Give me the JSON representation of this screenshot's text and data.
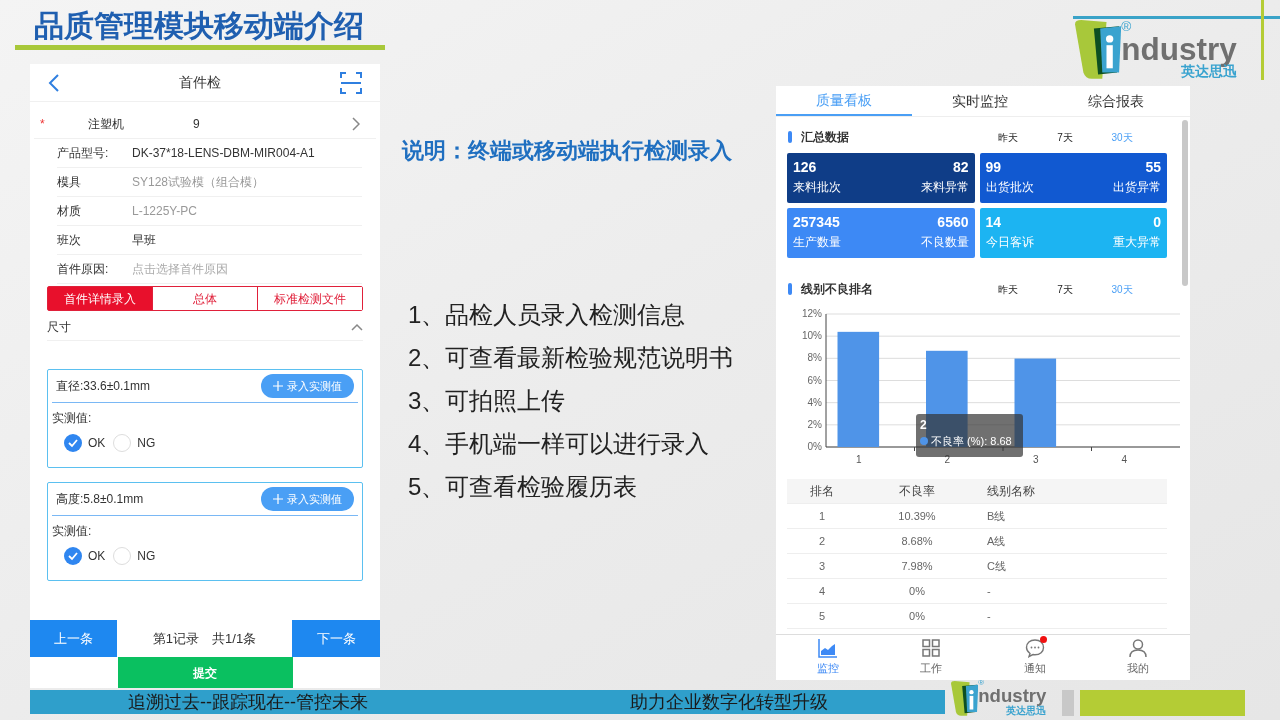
{
  "slide_title": "品质管理模块移动端介绍",
  "logo": {
    "registered": "®",
    "word": "ndustry",
    "subtitle": "英达思迅"
  },
  "description": "说明：终端或移动端执行检测录入",
  "points": [
    "1、品检人员录入检测信息",
    "2、可查看最新检验规范说明书",
    "3、可拍照上传",
    "4、手机端一样可以进行录入",
    "5、可查看检验履历表"
  ],
  "inspection_app": {
    "title": "首件检",
    "machine": {
      "required_mark": "*",
      "label": "注塑机",
      "value": "9"
    },
    "fields": [
      {
        "label": "产品型号:",
        "value": "DK-37*18-LENS-DBM-MIR004-A1",
        "muted": false
      },
      {
        "label": "模具",
        "value": "SY128试验模（组合模）",
        "muted": true
      },
      {
        "label": "材质",
        "value": "L-1225Y-PC",
        "muted": true
      },
      {
        "label": "班次",
        "value": "早班",
        "muted": false
      },
      {
        "label": "首件原因:",
        "placeholder": "点击选择首件原因"
      }
    ],
    "tabs": [
      {
        "label": "首件详情录入",
        "selected": true
      },
      {
        "label": "总体",
        "selected": false
      },
      {
        "label": "标准检测文件",
        "selected": false
      }
    ],
    "section": {
      "title": "尺寸",
      "expanded": true
    },
    "measurements": [
      {
        "spec": "直径:33.6±0.1mm",
        "button": "录入实测值",
        "value_label": "实测值:",
        "options": [
          {
            "label": "OK",
            "selected": true
          },
          {
            "label": "NG",
            "selected": false
          }
        ]
      },
      {
        "spec": "高度:5.8±0.1mm",
        "button": "录入实测值",
        "value_label": "实测值:",
        "options": [
          {
            "label": "OK",
            "selected": true
          },
          {
            "label": "NG",
            "selected": false
          }
        ]
      }
    ],
    "prev_button": "上一条",
    "record_info": "第1记录　共1/1条",
    "next_button": "下一条",
    "submit_button": "提交"
  },
  "dashboard_app": {
    "tabs": [
      {
        "label": "质量看板",
        "selected": true
      },
      {
        "label": "实时监控",
        "selected": false
      },
      {
        "label": "综合报表",
        "selected": false
      }
    ],
    "summary": {
      "title": "汇总数据",
      "periods": [
        {
          "label": "昨天",
          "selected": false
        },
        {
          "label": "7天",
          "selected": false
        },
        {
          "label": "30天",
          "selected": true
        }
      ],
      "cards": [
        {
          "left_value": "126",
          "left_label": "来料批次",
          "right_value": "82",
          "right_label": "来料异常",
          "color": "#0f3d87"
        },
        {
          "left_value": "99",
          "left_label": "出货批次",
          "right_value": "55",
          "right_label": "出货异常",
          "color": "#1159d1"
        },
        {
          "left_value": "257345",
          "left_label": "生产数量",
          "right_value": "6560",
          "right_label": "不良数量",
          "color": "#3d89f5"
        },
        {
          "left_value": "14",
          "left_label": "今日客诉",
          "right_value": "0",
          "right_label": "重大异常",
          "color": "#1cb4f2"
        }
      ]
    },
    "ranking": {
      "title": "线别不良排名",
      "periods": [
        {
          "label": "昨天",
          "selected": false
        },
        {
          "label": "7天",
          "selected": false
        },
        {
          "label": "30天",
          "selected": true
        }
      ],
      "chart_data": {
        "type": "bar",
        "grid": true,
        "categories": [
          "1",
          "2",
          "3",
          "4"
        ],
        "series": [
          {
            "name": "不良率 (%)",
            "color": "#4f94e8",
            "values": [
              10.39,
              8.68,
              7.98,
              0
            ]
          }
        ],
        "ylim": [
          0,
          12
        ],
        "yticks": [
          {
            "value": 0,
            "label": "0%"
          },
          {
            "value": 2,
            "label": "2%"
          },
          {
            "value": 4,
            "label": "4%"
          },
          {
            "value": 6,
            "label": "6%"
          },
          {
            "value": 8,
            "label": "8%"
          },
          {
            "value": 10,
            "label": "10%"
          },
          {
            "value": 12,
            "label": "12%"
          }
        ]
      },
      "tooltip": {
        "title": "2",
        "separator": ":",
        "value": "8.68"
      },
      "table": {
        "columns": [
          "排名",
          "不良率",
          "线别名称"
        ],
        "rows": [
          [
            "1",
            "10.39%",
            "B线"
          ],
          [
            "2",
            "8.68%",
            "A线"
          ],
          [
            "3",
            "7.98%",
            "C线"
          ],
          [
            "4",
            "0%",
            "-"
          ],
          [
            "5",
            "0%",
            "-"
          ]
        ]
      }
    },
    "nav": [
      {
        "label": "监控",
        "selected": true,
        "badge": false
      },
      {
        "label": "工作",
        "selected": false,
        "badge": false
      },
      {
        "label": "通知",
        "selected": false,
        "badge": true
      },
      {
        "label": "我的",
        "selected": false,
        "badge": false
      }
    ]
  },
  "footer": {
    "left": "追溯过去--跟踪现在--管控未来",
    "right": "助力企业数字化转型升级",
    "logo": {
      "registered": "®",
      "word": "ndustry",
      "subtitle": "英达思迅"
    }
  }
}
